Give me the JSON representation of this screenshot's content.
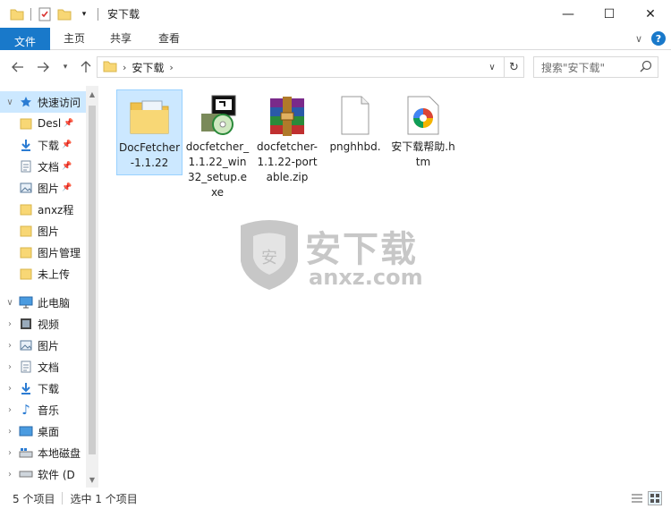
{
  "window": {
    "title": "安下载",
    "minimize": "—",
    "maximize": "☐",
    "close": "✕"
  },
  "ribbon": {
    "tabs": [
      "文件",
      "主页",
      "共享",
      "查看"
    ],
    "expand": "∨",
    "help": "?"
  },
  "address": {
    "crumb": "安下载",
    "search_placeholder": "搜索\"安下载\""
  },
  "nav": {
    "quick_access": "快速访问",
    "quick_items": [
      "Desl",
      "下载",
      "文档",
      "图片",
      "anxz程",
      "图片",
      "图片管理",
      "未上传"
    ],
    "this_pc": "此电脑",
    "pc_items": [
      "视频",
      "图片",
      "文档",
      "下载",
      "音乐",
      "桌面",
      "本地磁盘",
      "软件 (D"
    ]
  },
  "files": [
    {
      "name": "DocFetcher-1.1.22",
      "icon": "folder-icon",
      "selected": true
    },
    {
      "name": "docfetcher_1.1.22_win32_setup.exe",
      "icon": "installer-icon",
      "selected": false
    },
    {
      "name": "docfetcher-1.1.22-portable.zip",
      "icon": "winrar-archive-icon",
      "selected": false
    },
    {
      "name": "pnghhbd.",
      "icon": "blank-file-icon",
      "selected": false
    },
    {
      "name": "安下载帮助.htm",
      "icon": "html-file-icon",
      "selected": false
    }
  ],
  "watermark": {
    "text_cn": "安下载",
    "text_en": "anxz.com"
  },
  "status": {
    "count": "5 个项目",
    "selected": "选中 1 个项目"
  },
  "colors": {
    "accent": "#1979ca",
    "selection": "#cce8ff",
    "folder": "#f8d775"
  }
}
